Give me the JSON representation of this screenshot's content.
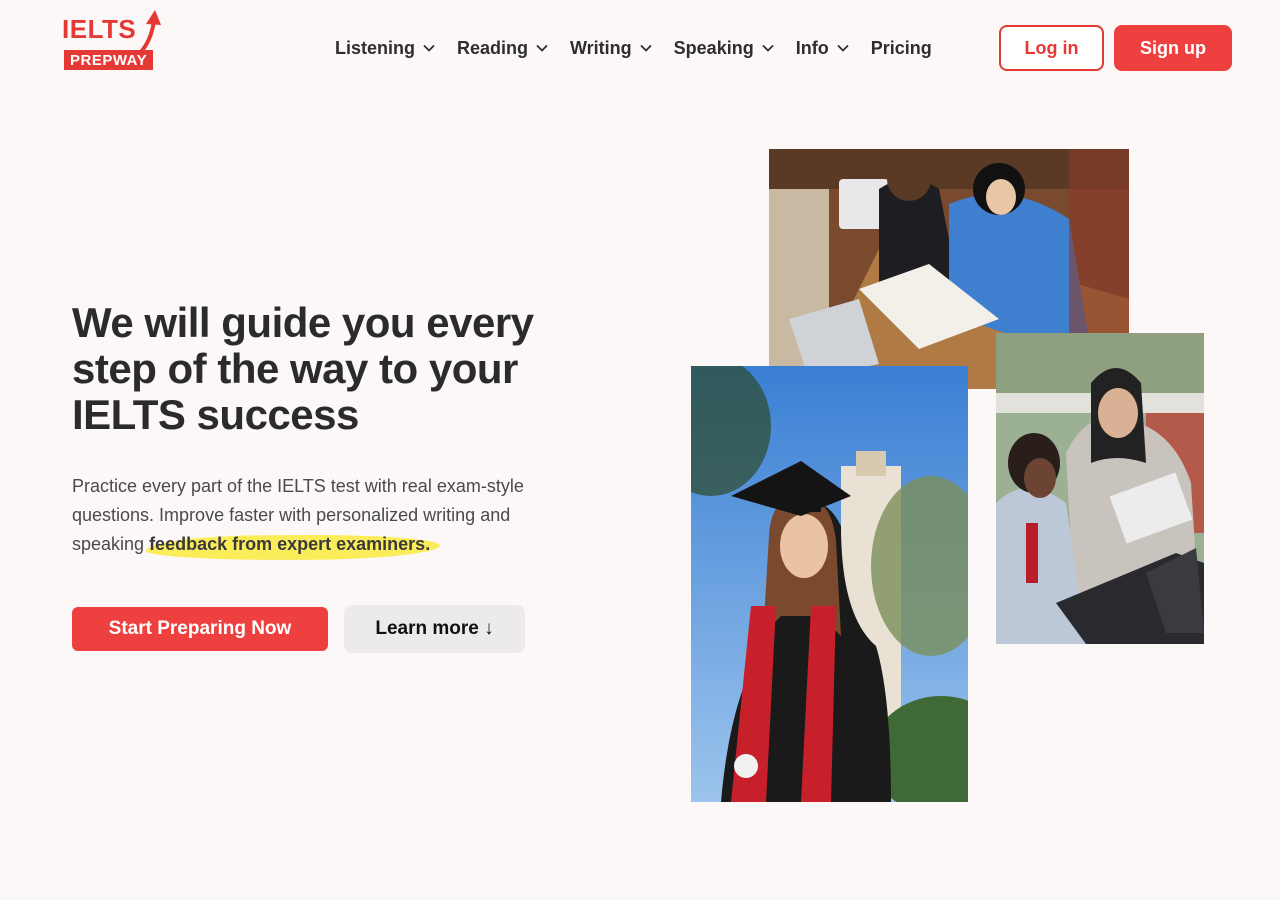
{
  "brand": {
    "name_top": "IELTS",
    "name_bottom": "PREPWAY",
    "color": "#e53935"
  },
  "nav": {
    "items": [
      {
        "label": "Listening",
        "has_dropdown": true
      },
      {
        "label": "Reading",
        "has_dropdown": true
      },
      {
        "label": "Writing",
        "has_dropdown": true
      },
      {
        "label": "Speaking",
        "has_dropdown": true
      },
      {
        "label": "Info",
        "has_dropdown": true
      },
      {
        "label": "Pricing",
        "has_dropdown": false
      }
    ],
    "login_label": "Log in",
    "signup_label": "Sign up",
    "dropdown_icon": "chevron-down-icon"
  },
  "hero": {
    "title": "We will guide you every step of the way to your IELTS success",
    "description_text": "Practice every part of the IELTS test with real exam-style questions. Improve faster with personalized writing and speaking ",
    "description_highlight": "feedback from expert examiners.",
    "highlight_color": "#fbed5a",
    "primary_cta": "Start Preparing Now",
    "secondary_cta": "Learn more ↓"
  },
  "colors": {
    "accent": "#ef4040",
    "background": "#fcf8f7",
    "text": "#2b2b2b"
  }
}
